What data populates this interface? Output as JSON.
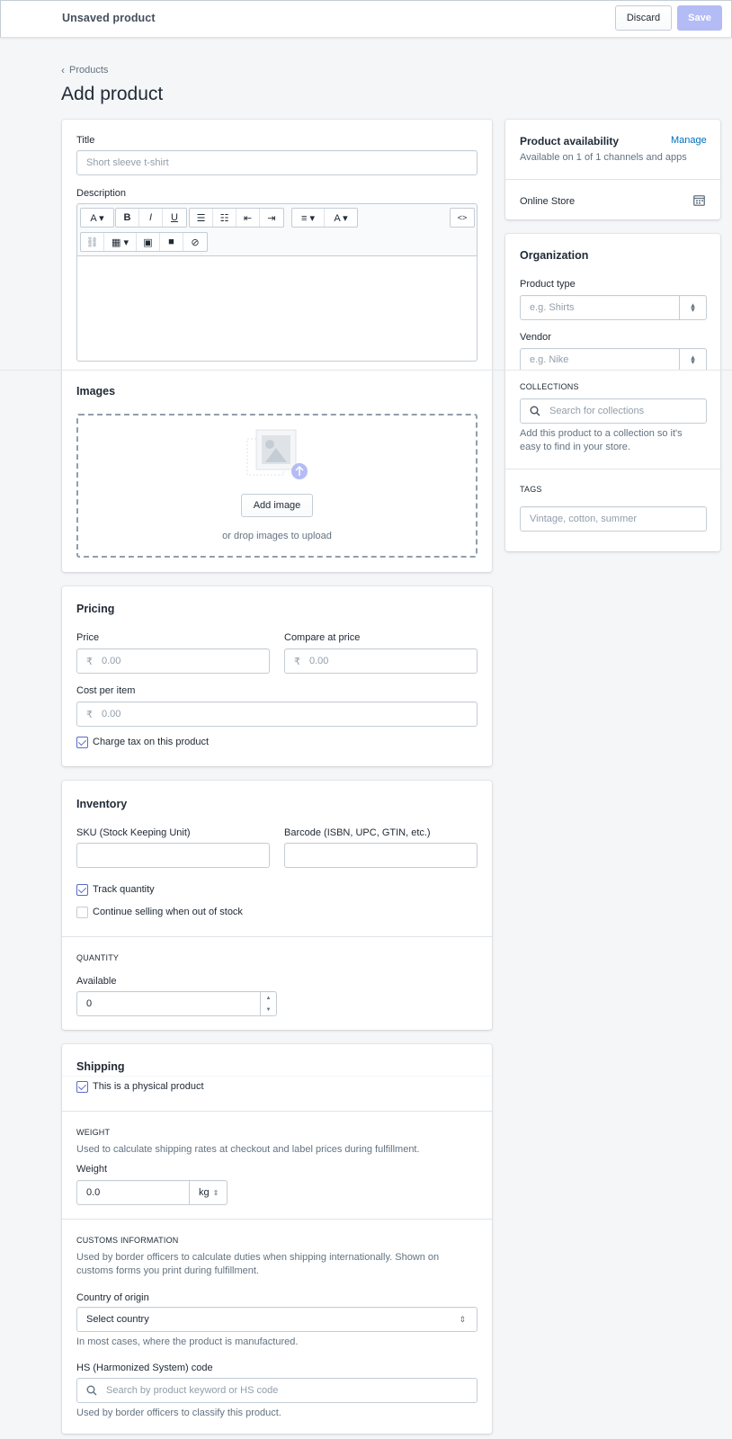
{
  "topbar": {
    "title": "Unsaved product",
    "discard": "Discard",
    "save": "Save"
  },
  "breadcrumb": {
    "label": "Products"
  },
  "page_title": "Add product",
  "main": {
    "title_label": "Title",
    "title_placeholder": "Short sleeve t-shirt",
    "description_label": "Description",
    "images_title": "Images",
    "add_image": "Add image",
    "drop_text": "or drop images to upload"
  },
  "pricing": {
    "title": "Pricing",
    "price_label": "Price",
    "compare_label": "Compare at price",
    "cost_label": "Cost per item",
    "currency": "₹",
    "price_value": "0.00",
    "compare_value": "0.00",
    "cost_value": "0.00",
    "charge_tax": "Charge tax on this product"
  },
  "inventory": {
    "title": "Inventory",
    "sku_label": "SKU (Stock Keeping Unit)",
    "barcode_label": "Barcode (ISBN, UPC, GTIN, etc.)",
    "track_quantity": "Track quantity",
    "continue_selling": "Continue selling when out of stock",
    "quantity_heading": "QUANTITY",
    "available_label": "Available",
    "available_value": "0"
  },
  "shipping": {
    "title": "Shipping",
    "physical": "This is a physical product",
    "weight_heading": "WEIGHT",
    "weight_help": "Used to calculate shipping rates at checkout and label prices during fulfillment.",
    "weight_label": "Weight",
    "weight_value": "0.0",
    "weight_unit": "kg",
    "customs_heading": "CUSTOMS INFORMATION",
    "customs_help_1": "Used by border officers to calculate duties when shipping internationally. Shown on",
    "customs_help_2": "customs forms you print during fulfillment.",
    "country_label": "Country of origin",
    "country_value": "Select country",
    "country_help": "In most cases, where the product is manufactured.",
    "hs_label": "HS (Harmonized System) code",
    "hs_placeholder": "Search by product keyword or HS code",
    "hs_help": "Used by border officers to classify this product."
  },
  "availability": {
    "title": "Product availability",
    "manage": "Manage",
    "subtitle": "Available on 1 of 1 channels and apps",
    "channel": "Online Store"
  },
  "organization": {
    "title": "Organization",
    "type_label": "Product type",
    "type_placeholder": "e.g. Shirts",
    "vendor_label": "Vendor",
    "vendor_placeholder": "e.g. Nike",
    "collections_heading": "COLLECTIONS",
    "collections_placeholder": "Search for collections",
    "collections_help_1": "Add this product to a collection so it's",
    "collections_help_2": "easy to find in your store.",
    "tags_heading": "TAGS",
    "tags_placeholder": "Vintage, cotton, summer"
  },
  "colors": {
    "accent": "#5c6ac4",
    "link": "#006fbb",
    "save_disabled": "#b3bcf5"
  }
}
